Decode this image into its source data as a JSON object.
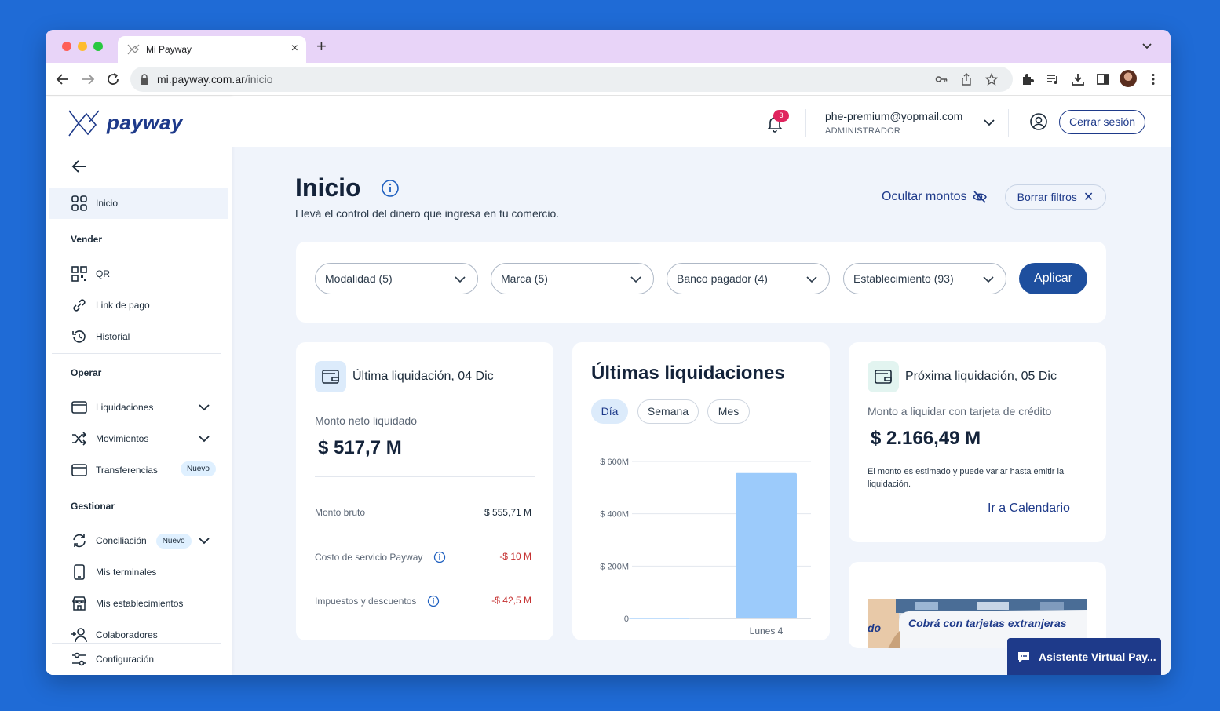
{
  "browser": {
    "tab_title": "Mi Payway",
    "url_host": "mi.payway.com.ar",
    "url_path": "/inicio"
  },
  "brand": {
    "name": "payway",
    "primary_color": "#1e3a8a",
    "accent_color": "#1e4f9e"
  },
  "sidebar": {
    "home": "Inicio",
    "sections": {
      "vender": "Vender",
      "operar": "Operar",
      "gestionar": "Gestionar"
    },
    "vender_items": [
      "QR",
      "Link de pago",
      "Historial"
    ],
    "operar_items": [
      "Liquidaciones",
      "Movimientos",
      "Transferencias"
    ],
    "gestionar_items": [
      "Conciliación",
      "Mis terminales",
      "Mis establecimientos",
      "Colaboradores"
    ],
    "config": "Configuración",
    "new_badge": "Nuevo"
  },
  "header": {
    "notifications_count": "3",
    "user_email": "phe-premium@yopmail.com",
    "user_role": "ADMINISTRADOR",
    "logout_label": "Cerrar sesión"
  },
  "page": {
    "title": "Inicio",
    "subtitle": "Llevá el control del dinero que ingresa en tu comercio.",
    "hide_amounts": "Ocultar montos",
    "clear_filters": "Borrar filtros"
  },
  "filters": {
    "modalidad": "Modalidad (5)",
    "marca": "Marca (5)",
    "banco": "Banco pagador (4)",
    "establecimiento": "Establecimiento (93)",
    "apply": "Aplicar"
  },
  "last_settlement": {
    "title": "Última liquidación, 04 Dic",
    "net_label": "Monto neto liquidado",
    "net_amount": "$ 517,7 M",
    "gross_label": "Monto bruto",
    "gross_value": "$ 555,71 M",
    "service_label": "Costo de servicio Payway",
    "service_value": "-$ 10 M",
    "taxes_label": "Impuestos y descuentos",
    "taxes_value": "-$ 42,5 M"
  },
  "chart_card": {
    "title": "Últimas liquidaciones",
    "periods": [
      "Día",
      "Semana",
      "Mes"
    ],
    "active_period": "Día"
  },
  "chart_data": {
    "type": "bar",
    "categories": [
      "",
      "Lunes 4"
    ],
    "values": [
      0,
      555.71
    ],
    "ylim": [
      0,
      600
    ],
    "yticks": [
      0,
      200,
      400,
      600
    ],
    "ytick_labels": [
      "0",
      "$ 200M",
      "$ 400M",
      "$ 600M"
    ],
    "title": "",
    "xlabel": "",
    "ylabel": "",
    "grid": true,
    "bar_color": "#9ccbfb"
  },
  "next_settlement": {
    "title": "Próxima liquidación, 05 Dic",
    "label": "Monto a liquidar con tarjeta de crédito",
    "amount": "$ 2.166,49 M",
    "note": "El monto es estimado y puede variar hasta emitir la liquidación.",
    "link": "Ir a Calendario"
  },
  "promo": {
    "text": "Cobrá con tarjetas extranjeras",
    "prefix": "do"
  },
  "assistant": {
    "label": "Asistente Virtual Pay..."
  }
}
